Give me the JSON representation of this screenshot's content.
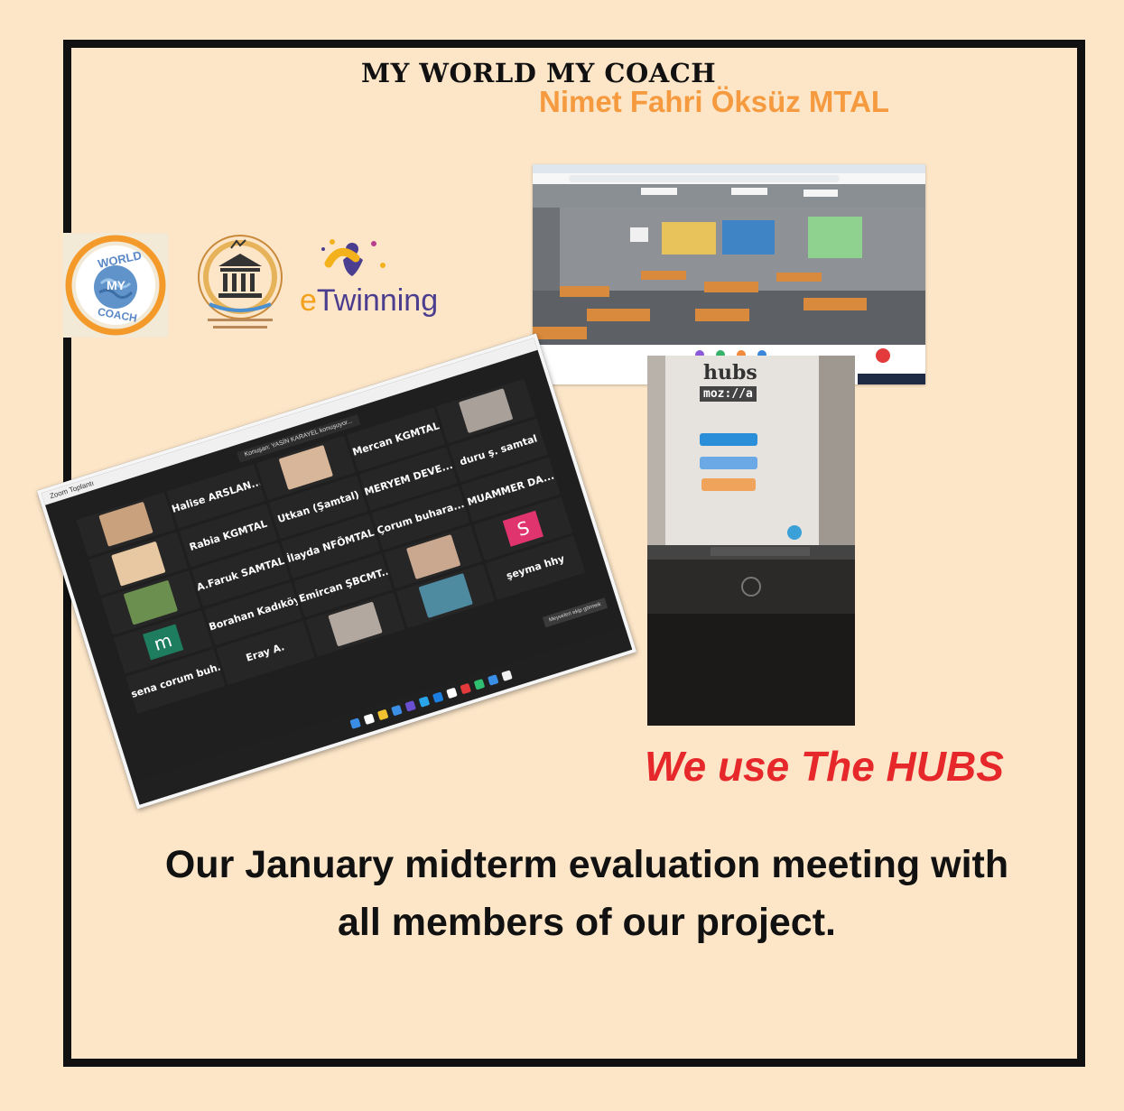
{
  "poster": {
    "title": "MY WORLD MY COACH",
    "subtitle": "Nimet Fahri Öksüz MTAL",
    "tagline": "We use The HUBS",
    "caption_line1": "Our January midterm evaluation meeting with",
    "caption_line2": "all members of our project."
  },
  "logos": {
    "wmc_top": "WORLD",
    "wmc_mid": "MY",
    "wmc_bottom": "COACH",
    "etwinning_e": "e",
    "etwinning_rest": "Twinning"
  },
  "hubs_photo": {
    "brand": "hubs",
    "sub_brand": "moz://a"
  },
  "zoom": {
    "window_title": "Zoom Toplantı",
    "talking": "Konuşan: YASİN KARAYEL konuşuyor...",
    "tiles": [
      {
        "name": "",
        "type": "photo",
        "color": "#c9a27d"
      },
      {
        "name": "Halise ARSLAN...",
        "type": "name"
      },
      {
        "name": "",
        "type": "photo",
        "color": "#d8b69a"
      },
      {
        "name": "Mercan KGMTAL",
        "type": "name"
      },
      {
        "name": "",
        "type": "photo",
        "color": "#a9a09a"
      },
      {
        "name": "",
        "type": "photo",
        "color": "#e8c7a3"
      },
      {
        "name": "Rabia KGMTAL",
        "type": "name"
      },
      {
        "name": "Utkan (Şamtal)",
        "type": "name"
      },
      {
        "name": "MERYEM DEVE...",
        "type": "name"
      },
      {
        "name": "duru ş. samtal",
        "type": "name"
      },
      {
        "name": "",
        "type": "photo",
        "color": "#6b8f4e"
      },
      {
        "name": "A.Faruk SAMTAL",
        "type": "name"
      },
      {
        "name": "İlayda NFÖMTAL",
        "type": "name"
      },
      {
        "name": "Çorum buhara...",
        "type": "name"
      },
      {
        "name": "MUAMMER DA...",
        "type": "name"
      },
      {
        "name": "m",
        "type": "letter",
        "color": "#1e7d5f"
      },
      {
        "name": "Borahan Kadıköy",
        "type": "name"
      },
      {
        "name": "Emircan ŞBCMT...",
        "type": "name"
      },
      {
        "name": "",
        "type": "photo",
        "color": "#caa890"
      },
      {
        "name": "S",
        "type": "letter",
        "color": "#e0346f"
      },
      {
        "name": "sena corum buh...",
        "type": "name"
      },
      {
        "name": "Eray A.",
        "type": "name"
      },
      {
        "name": "",
        "type": "photo",
        "color": "#b3a8a0"
      },
      {
        "name": "",
        "type": "photo",
        "color": "#4e8aa0"
      },
      {
        "name": "şeyma hhy",
        "type": "name"
      }
    ],
    "taskbar_icons": [
      "#3a8ee6",
      "#ffffff",
      "#f2c230",
      "#3a8ee6",
      "#6a4fd1",
      "#2aa4e8",
      "#1b7ee0",
      "#ffffff",
      "#e33b3b",
      "#2fbf71",
      "#3a8ee6",
      "#f0f0f0"
    ],
    "tip": "Meyveleri ekip görmek"
  }
}
